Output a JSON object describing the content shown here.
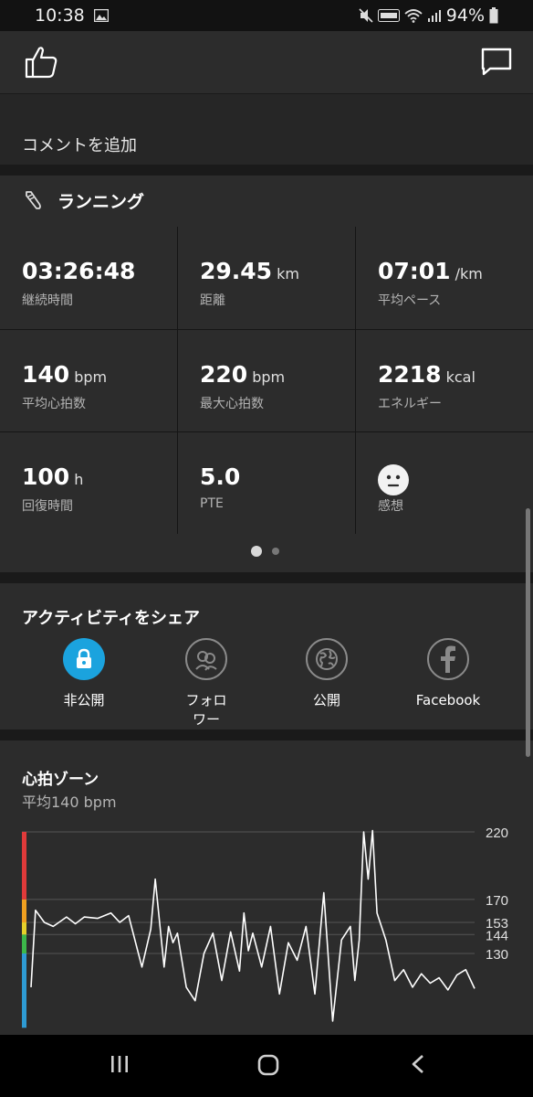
{
  "status_bar": {
    "time": "10:38",
    "battery": "94%"
  },
  "comment": {
    "placeholder": "コメントを追加"
  },
  "activity": {
    "title": "ランニング",
    "stats": [
      {
        "value": "03:26:48",
        "unit": "",
        "label": "継続時間"
      },
      {
        "value": "29.45",
        "unit": "km",
        "label": "距離"
      },
      {
        "value": "07:01",
        "unit": "/km",
        "label": "平均ペース"
      },
      {
        "value": "140",
        "unit": "bpm",
        "label": "平均心拍数"
      },
      {
        "value": "220",
        "unit": "bpm",
        "label": "最大心拍数"
      },
      {
        "value": "2218",
        "unit": "kcal",
        "label": "エネルギー"
      },
      {
        "value": "100",
        "unit": "h",
        "label": "回復時間"
      },
      {
        "value": "5.0",
        "unit": "",
        "label": "PTE"
      },
      {
        "value": "",
        "unit": "",
        "label": "感想"
      }
    ]
  },
  "share": {
    "title": "アクティビティをシェア",
    "options": [
      {
        "label": "非公開",
        "icon": "lock-icon",
        "selected": true
      },
      {
        "label": "フォロ\nワー",
        "icon": "followers-icon",
        "selected": false
      },
      {
        "label": "公開",
        "icon": "globe-icon",
        "selected": false
      },
      {
        "label": "Facebook",
        "icon": "facebook-icon",
        "selected": false
      }
    ]
  },
  "heart_rate": {
    "title": "心拍ゾーン",
    "subtitle": "平均140 bpm"
  },
  "chart_data": {
    "type": "line",
    "title": "心拍ゾーン",
    "ylabel": "",
    "y_ticks": [
      220,
      170,
      153,
      144,
      130
    ],
    "ylim": [
      75,
      220
    ],
    "grid": true,
    "zones": [
      {
        "from": 75,
        "to": 130,
        "color": "#2e9bd4"
      },
      {
        "from": 130,
        "to": 144,
        "color": "#3cb84a"
      },
      {
        "from": 144,
        "to": 153,
        "color": "#e6d02a"
      },
      {
        "from": 153,
        "to": 170,
        "color": "#f0a020"
      },
      {
        "from": 170,
        "to": 220,
        "color": "#e03a3a"
      }
    ],
    "series": [
      {
        "x": [
          0,
          1,
          3,
          5,
          8,
          10,
          12,
          15,
          18,
          20,
          22,
          25,
          27,
          28,
          30,
          31,
          32,
          33,
          35,
          37,
          39,
          41,
          43,
          45,
          47,
          48,
          49,
          50,
          52,
          54,
          56,
          58,
          60,
          62,
          64,
          66,
          68,
          70,
          72,
          73,
          74,
          75,
          76,
          77,
          78,
          80,
          82,
          84,
          86,
          88,
          90,
          92,
          94,
          96,
          98,
          100
        ],
        "values": [
          105,
          162,
          153,
          150,
          157,
          152,
          157,
          156,
          160,
          153,
          158,
          120,
          148,
          185,
          120,
          150,
          138,
          145,
          105,
          95,
          130,
          145,
          110,
          146,
          117,
          160,
          132,
          145,
          120,
          150,
          100,
          138,
          125,
          150,
          100,
          175,
          80,
          140,
          150,
          110,
          140,
          220,
          185,
          221,
          160,
          140,
          110,
          118,
          105,
          115,
          108,
          112,
          103,
          114,
          118,
          104
        ]
      }
    ]
  }
}
